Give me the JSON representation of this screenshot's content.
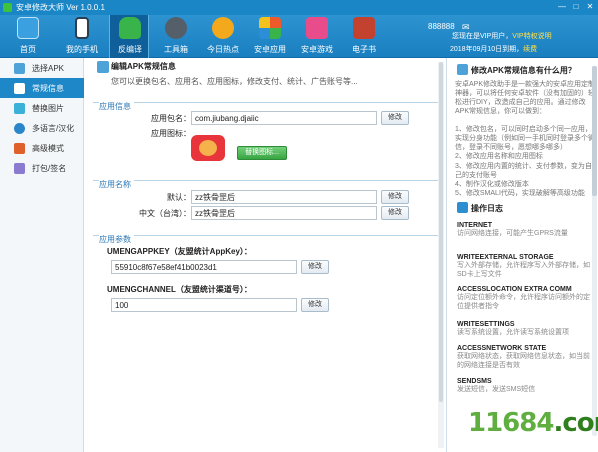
{
  "window": {
    "title": "安卓修改大师 Ver 1.0.0.1"
  },
  "toolbar": {
    "buttons": [
      {
        "label": "首页",
        "icon": "home-icon",
        "color": "#3aa0e0"
      },
      {
        "label": "我的手机",
        "icon": "phone-icon",
        "color": "#ffffff"
      },
      {
        "label": "反编译",
        "icon": "android-icon",
        "color": "#38b44a"
      },
      {
        "label": "工具箱",
        "icon": "toolbox-icon",
        "color": "#555f6a"
      },
      {
        "label": "今日热点",
        "icon": "star-icon",
        "color": "#f4a91c"
      },
      {
        "label": "安卓应用",
        "icon": "apps-icon",
        "color": "#ef5a2a"
      },
      {
        "label": "安卓游戏",
        "icon": "game-icon",
        "color": "#e84c8b"
      },
      {
        "label": "电子书",
        "icon": "books-icon",
        "color": "#c2412f"
      }
    ]
  },
  "account": {
    "username": "888888",
    "vip_text": "您现在是VIP用户，",
    "vip_link": "VIP特权说明",
    "expire_text": "2018年09月10日到期，",
    "renew_link": "续费"
  },
  "sidebar": {
    "items": [
      {
        "label": "选择APK",
        "icon": "apk-icon",
        "color": "#4da3d8"
      },
      {
        "label": "常规信息",
        "icon": "info-icon",
        "color": "#ffffff"
      },
      {
        "label": "替换图片",
        "icon": "image-icon",
        "color": "#3bb0d8"
      },
      {
        "label": "多语言/汉化",
        "icon": "globe-icon",
        "color": "#2b86c9"
      },
      {
        "label": "高级模式",
        "icon": "advanced-icon",
        "color": "#e0602c"
      },
      {
        "label": "打包/签名",
        "icon": "package-icon",
        "color": "#8a7bd1"
      }
    ]
  },
  "main": {
    "header_title": "编辑APK常规信息",
    "header_desc": "您可以更换包名、应用名、应用图标，修改支付、统计、广告账号等...",
    "app_info": {
      "section_title": "应用信息",
      "package_label": "应用包名：",
      "package_value": "com.jiubang.djaiic",
      "modify_label": "修改",
      "icon_label": "应用图标：",
      "replace_icon_label": "替换图标..."
    },
    "app_name": {
      "section_title": "应用名称",
      "default_label": "默认：",
      "default_value": "zz铁骨罡后",
      "tw_label": "中文（台湾）：",
      "tw_value": "zz铁骨罡后",
      "modify_label": "修改"
    },
    "app_params": {
      "section_title": "应用参数",
      "appkey_label": "UMENGAPPKEY（友盟统计AppKey）：",
      "appkey_value": "55910c8f67e58ef41b0023d1",
      "channel_label": "UMENGCHANNEL（友盟统计渠道号）：",
      "channel_value": "100",
      "modify_label": "修改"
    }
  },
  "right": {
    "q_title": "修改APK常规信息有什么用？",
    "q_intro": "安卓APK修改助手是一款强大的安卓应用定制神器，可以将任何安卓软件（没有加固的）轻松进行DIY，改造成自己的应用。通过修改APK常规信息，你可以做到：",
    "q_points": [
      "1、修改包名，可以同时启动多个同一应用，实现分身功能（例如同一手机同时登录多个微信，登录不同账号，愿想哪多哪多）",
      "2、修改应用名称和应用图标",
      "3、修改应用内置的统计、支付参数，变为自己的支付账号",
      "4、制作汉化或修改版本",
      "5、修改SMALI代码，实现破解等高级功能"
    ],
    "log_title": "操作日志",
    "perms": [
      {
        "name": "INTERNET",
        "desc": "访问网络连接，可能产生GPRS流量"
      },
      {
        "name": "WRITEEXTERNAL STORAGE",
        "desc": "写入外部存储，允许程序写入外部存储，如SD卡上写文件"
      },
      {
        "name": "ACCESSLOCATION EXTRA COMM",
        "desc": "访问定位额外命令，允许程序访问额外的定位提供者指令"
      },
      {
        "name": "WRITESETTINGS",
        "desc": "读写系统设置，允许读写系统设置项"
      },
      {
        "name": "ACCESSNETWORK STATE",
        "desc": "获取网络状态，获取网络信息状态，如当前的网络连接是否有效"
      },
      {
        "name": "SENDSMS",
        "desc": "发送短信，发送SMS短信"
      }
    ]
  },
  "watermark": {
    "text": "11684",
    "suffix": ".com"
  }
}
